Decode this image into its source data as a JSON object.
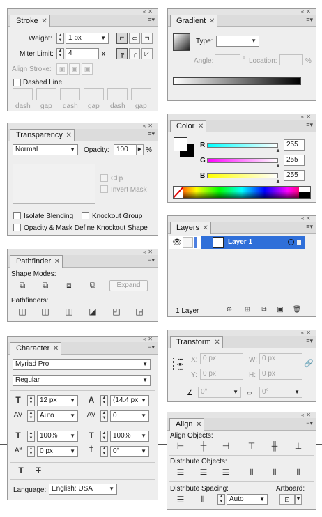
{
  "stroke": {
    "tab": "Stroke",
    "weight_label": "Weight:",
    "weight_value": "1 px",
    "miter_label": "Miter Limit:",
    "miter_value": "4",
    "miter_unit": "x",
    "align_label": "Align Stroke:",
    "dashed_label": "Dashed Line",
    "dash_labels": [
      "dash",
      "gap",
      "dash",
      "gap",
      "dash",
      "gap"
    ]
  },
  "gradient": {
    "tab": "Gradient",
    "type_label": "Type:",
    "angle_label": "Angle:",
    "angle_unit": "°",
    "location_label": "Location:",
    "location_unit": "%"
  },
  "transparency": {
    "tab": "Transparency",
    "mode": "Normal",
    "opacity_label": "Opacity:",
    "opacity_value": "100",
    "opacity_unit": "%",
    "clip_label": "Clip",
    "invert_label": "Invert Mask",
    "isolate_label": "Isolate Blending",
    "knockout_label": "Knockout Group",
    "opacity_mask_label": "Opacity & Mask Define Knockout Shape"
  },
  "color": {
    "tab": "Color",
    "channels": [
      {
        "name": "R",
        "value": "255"
      },
      {
        "name": "G",
        "value": "255"
      },
      {
        "name": "B",
        "value": "255"
      }
    ]
  },
  "layers": {
    "tab": "Layers",
    "layer_name": "Layer 1",
    "count": "1 Layer"
  },
  "pathfinder": {
    "tab": "Pathfinder",
    "shape_modes_label": "Shape Modes:",
    "expand_label": "Expand",
    "pathfinders_label": "Pathfinders:"
  },
  "transform": {
    "tab": "Transform",
    "x_label": "X:",
    "x_value": "0 px",
    "y_label": "Y:",
    "y_value": "0 px",
    "w_label": "W:",
    "w_value": "0 px",
    "h_label": "H:",
    "h_value": "0 px",
    "rotate_value": "0°",
    "shear_value": "0°"
  },
  "character": {
    "tab": "Character",
    "font": "Myriad Pro",
    "style": "Regular",
    "size_value": "12 px",
    "leading_value": "(14.4 px",
    "kerning_value": "Auto",
    "tracking_value": "0",
    "vscale_value": "100%",
    "hscale_value": "100%",
    "baseline_value": "0 px",
    "rotation_value": "0°",
    "language_label": "Language:",
    "language_value": "English: USA"
  },
  "align": {
    "tab": "Align",
    "objects_label": "Align Objects:",
    "distribute_objects_label": "Distribute Objects:",
    "distribute_spacing_label": "Distribute Spacing:",
    "artboard_label": "Artboard:",
    "spacing_value": "Auto"
  }
}
